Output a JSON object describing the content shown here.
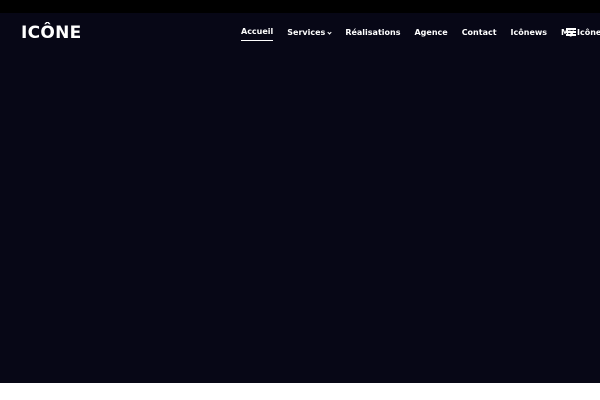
{
  "header": {
    "logo_text": "ICÔNE",
    "nav": [
      {
        "label": "Accueil",
        "active": true,
        "has_dropdown": false
      },
      {
        "label": "Services",
        "active": false,
        "has_dropdown": true
      },
      {
        "label": "Réalisations",
        "active": false,
        "has_dropdown": false
      },
      {
        "label": "Agence",
        "active": false,
        "has_dropdown": false
      },
      {
        "label": "Contact",
        "active": false,
        "has_dropdown": false
      },
      {
        "label": "Icônews",
        "active": false,
        "has_dropdown": false
      },
      {
        "label": "My Icône",
        "active": false,
        "has_dropdown": true
      }
    ],
    "menu_icon": "hamburger-menu-icon"
  },
  "colors": {
    "top_bar": "#000000",
    "hero_background": "#070716",
    "text": "#ffffff"
  }
}
